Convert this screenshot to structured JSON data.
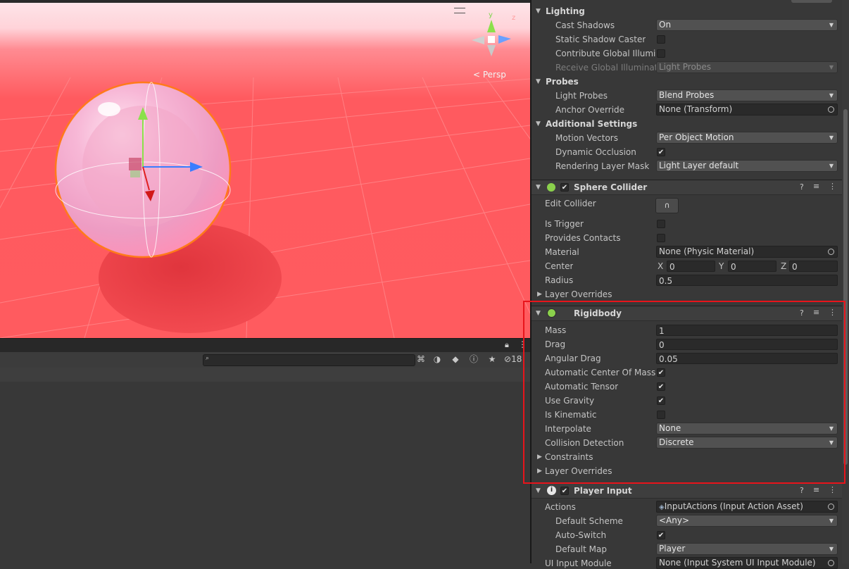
{
  "scene": {
    "persp_label": "< Persp"
  },
  "bottom_left": {
    "hidden_count": "18"
  },
  "lighting": {
    "title": "Lighting",
    "cast_shadows_label": "Cast Shadows",
    "cast_shadows_value": "On",
    "static_shadow_label": "Static Shadow Caster",
    "static_shadow_checked": false,
    "contribute_gi_label": "Contribute Global Illumina",
    "contribute_gi_checked": false,
    "receive_gi_label": "Receive Global Illuminatic",
    "receive_gi_value": "Light Probes"
  },
  "probes": {
    "title": "Probes",
    "light_probes_label": "Light Probes",
    "light_probes_value": "Blend Probes",
    "anchor_override_label": "Anchor Override",
    "anchor_override_value": "None (Transform)"
  },
  "additional": {
    "title": "Additional Settings",
    "motion_vectors_label": "Motion Vectors",
    "motion_vectors_value": "Per Object Motion",
    "dynamic_occlusion_label": "Dynamic Occlusion",
    "dynamic_occlusion_checked": true,
    "rendering_layer_label": "Rendering Layer Mask",
    "rendering_layer_value": "Light Layer default"
  },
  "sphere_collider": {
    "title": "Sphere Collider",
    "enabled": true,
    "edit_collider_label": "Edit Collider",
    "is_trigger_label": "Is Trigger",
    "is_trigger_checked": false,
    "provides_contacts_label": "Provides Contacts",
    "provides_contacts_checked": false,
    "material_label": "Material",
    "material_value": "None (Physic Material)",
    "center_label": "Center",
    "center_x_label": "X",
    "center_x": "0",
    "center_y_label": "Y",
    "center_y": "0",
    "center_z_label": "Z",
    "center_z": "0",
    "radius_label": "Radius",
    "radius_value": "0.5",
    "layer_overrides_label": "Layer Overrides"
  },
  "rigidbody": {
    "title": "Rigidbody",
    "mass_label": "Mass",
    "mass_value": "1",
    "drag_label": "Drag",
    "drag_value": "0",
    "angular_drag_label": "Angular Drag",
    "angular_drag_value": "0.05",
    "auto_com_label": "Automatic Center Of Mass",
    "auto_com_checked": true,
    "auto_tensor_label": "Automatic Tensor",
    "auto_tensor_checked": true,
    "use_gravity_label": "Use Gravity",
    "use_gravity_checked": true,
    "is_kinematic_label": "Is Kinematic",
    "is_kinematic_checked": false,
    "interpolate_label": "Interpolate",
    "interpolate_value": "None",
    "collision_detection_label": "Collision Detection",
    "collision_detection_value": "Discrete",
    "constraints_label": "Constraints",
    "layer_overrides_label": "Layer Overrides"
  },
  "player_input": {
    "title": "Player Input",
    "enabled": true,
    "actions_label": "Actions",
    "actions_value": "InputActions (Input Action Asset)",
    "default_scheme_label": "Default Scheme",
    "default_scheme_value": "<Any>",
    "auto_switch_label": "Auto-Switch",
    "auto_switch_checked": true,
    "default_map_label": "Default Map",
    "default_map_value": "Player",
    "ui_input_module_label": "UI Input Module",
    "ui_input_module_value": "None (Input System UI Input Module)"
  },
  "colors": {
    "highlight_box": "#e8141b",
    "scene_floor": "#ff5b5f",
    "inspector_bg": "#383838"
  }
}
